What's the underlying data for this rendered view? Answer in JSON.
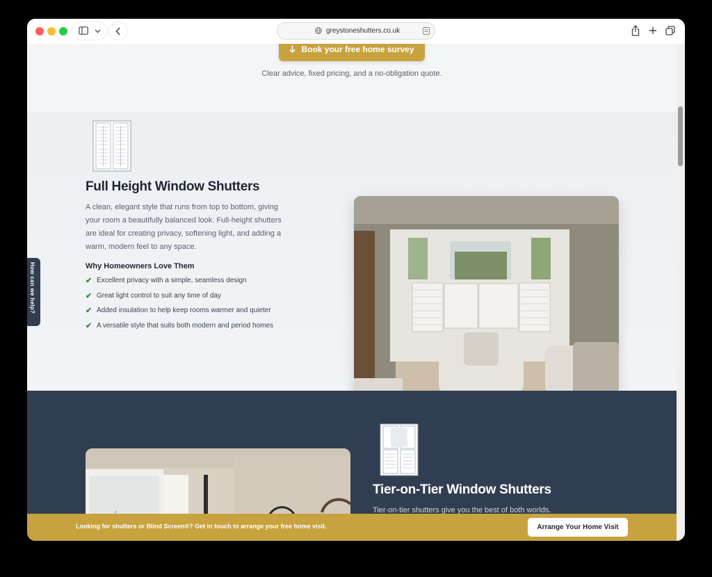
{
  "browser": {
    "url": "greystoneshutters.co.uk"
  },
  "hero": {
    "button_label": "Book your free home survey",
    "subtext": "Clear advice, fixed pricing, and a no-obligation quote."
  },
  "full_height": {
    "title": "Full Height Window Shutters",
    "description": "A clean, elegant style that runs from top to bottom, giving your room a beautifully balanced look. Full-height shutters are ideal for creating privacy, softening light, and adding a warm, modern feel to any space.",
    "benefits_heading": "Why Homeowners Love Them",
    "benefits": [
      "Excellent privacy with a simple, seamless design",
      "Great light control to suit any time of day",
      "Added insulation to help keep rooms warmer and quieter",
      "A versatile style that suits both modern and period homes"
    ]
  },
  "tier_on_tier": {
    "title": "Tier-on-Tier Window Shutters",
    "description": "Tier-on-tier shutters give you the best of both worlds."
  },
  "side_tab": {
    "label": "How can we help?"
  },
  "bottom_bar": {
    "text": "Looking for shutters or Blind Screen®? Get in touch to arrange your free home visit.",
    "cta_label": "Arrange Your Home Visit"
  },
  "colors": {
    "gold": "#c7a23e",
    "navy": "#313e51",
    "check_green": "#2e8b3c"
  }
}
